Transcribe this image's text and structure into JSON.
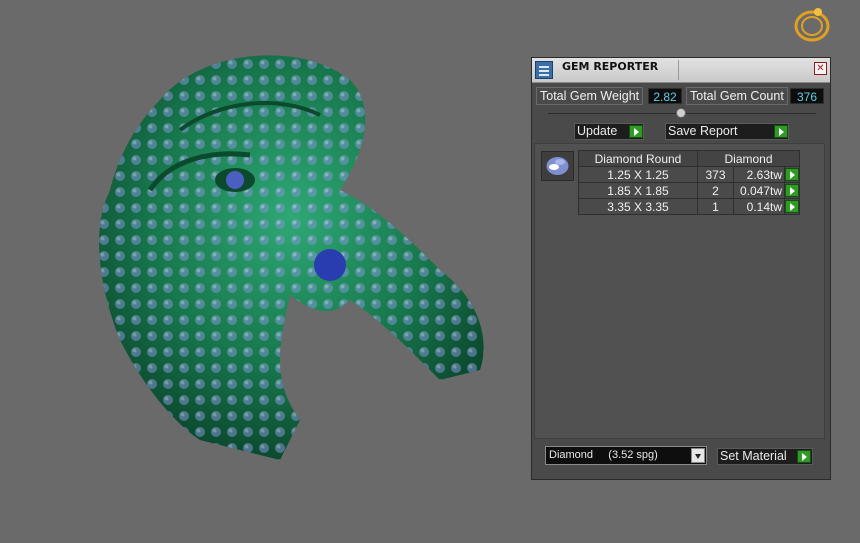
{
  "panel": {
    "title": "GEM REPORTER",
    "close_icon": "close-icon",
    "total_weight_label": "Total Gem Weight",
    "total_weight_value": "2.82",
    "total_count_label": "Total Gem Count",
    "total_count_value": "376",
    "update_label": "Update",
    "save_report_label": "Save Report",
    "table": {
      "headers": [
        "Diamond Round",
        "Diamond"
      ],
      "rows": [
        {
          "size": "1.25 X 1.25",
          "count": "373",
          "weight": "2.63tw"
        },
        {
          "size": "1.85 X 1.85",
          "count": "2",
          "weight": "0.047tw"
        },
        {
          "size": "3.35 X 3.35",
          "count": "1",
          "weight": "0.14tw"
        }
      ]
    },
    "material_selected": "Diamond     (3.52 spg)",
    "set_material_label": "Set Material"
  },
  "colors": {
    "panel_bg": "#4a4a4a",
    "value_text": "#5fd0e6",
    "play_green": "#2e9c24",
    "model_green": "#1e8a5a",
    "viewport_bg": "#6a6a6a"
  }
}
